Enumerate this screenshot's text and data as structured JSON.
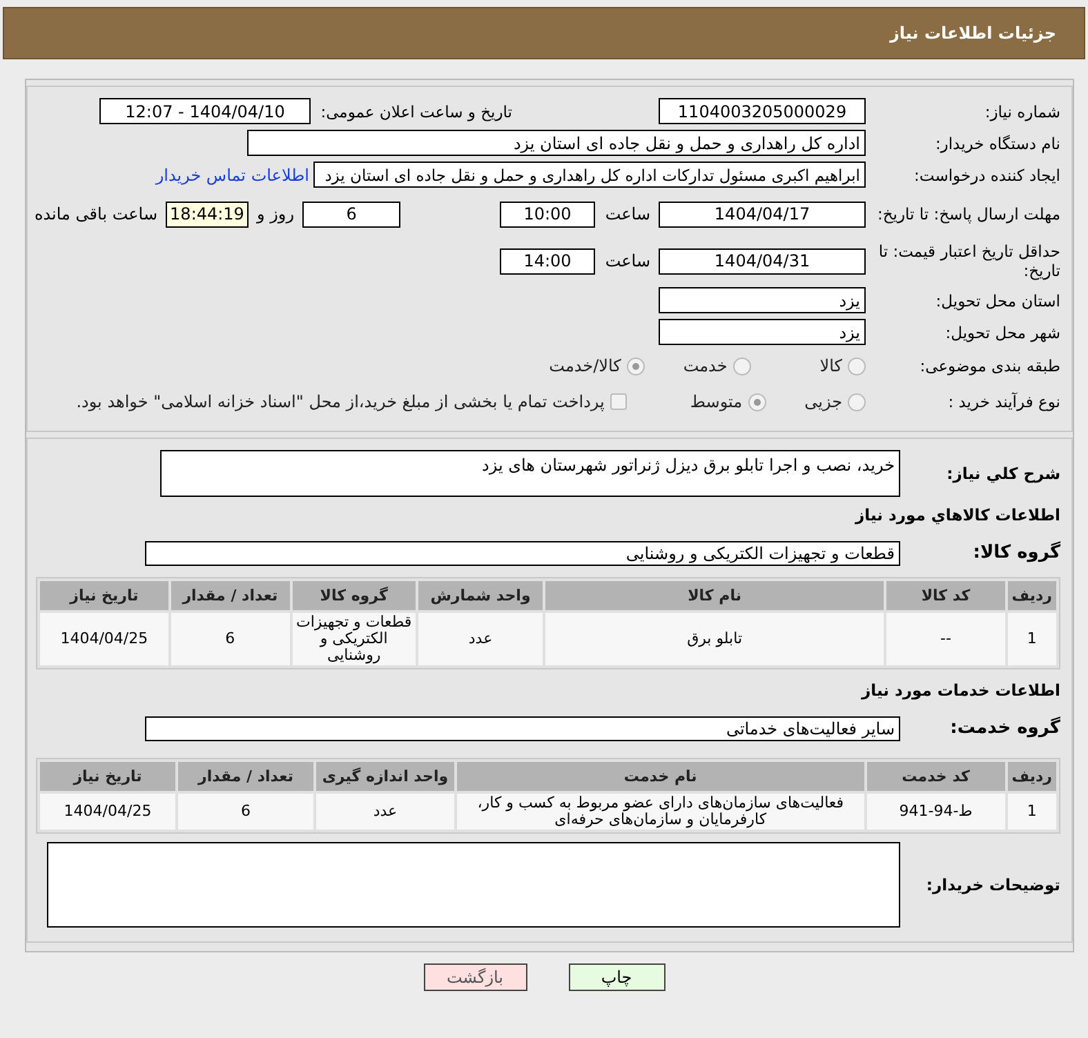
{
  "header": {
    "title": "جزئیات اطلاعات نیاز"
  },
  "need_number": {
    "label": "شماره نیاز:",
    "value": "1104003205000029"
  },
  "announce": {
    "label": "تاریخ و ساعت اعلان عمومی:",
    "value": "1404/04/10 - 12:07"
  },
  "buyer_org": {
    "label": "نام دستگاه خریدار:",
    "value": "اداره کل راهداری و حمل و نقل جاده ای استان یزد"
  },
  "requester": {
    "label": "ایجاد کننده درخواست:",
    "value": "ابراهیم اکبری مسئول تدارکات اداره کل راهداری و حمل و نقل جاده ای استان یزد",
    "link": "اطلاعات تماس خریدار"
  },
  "deadline": {
    "label": "مهلت ارسال پاسخ: تا تاریخ:",
    "date": "1404/04/17",
    "time_label": "ساعت",
    "time": "10:00",
    "days": "6",
    "days_label": "روز و",
    "remaining": "18:44:19",
    "remaining_label": "ساعت باقی مانده"
  },
  "validity": {
    "label": "حداقل تاریخ اعتبار قیمت: تا تاریخ:",
    "date": "1404/04/31",
    "time_label": "ساعت",
    "time": "14:00"
  },
  "province": {
    "label": "استان محل تحویل:",
    "value": "یزد"
  },
  "city": {
    "label": "شهر محل تحویل:",
    "value": "یزد"
  },
  "category": {
    "label": "طبقه بندی موضوعی:",
    "options": [
      {
        "label": "کالا",
        "selected": false
      },
      {
        "label": "خدمت",
        "selected": false
      },
      {
        "label": "کالا/خدمت",
        "selected": true
      }
    ]
  },
  "process": {
    "label": "نوع فرآیند خرید :",
    "options": [
      {
        "label": "جزیی",
        "selected": false
      },
      {
        "label": "متوسط",
        "selected": true
      }
    ],
    "payment": {
      "label": "پرداخت تمام یا بخشی از مبلغ خرید،از محل \"اسناد خزانه اسلامی\" خواهد بود.",
      "checked": false
    }
  },
  "description": {
    "label": "شرح کلي نياز:",
    "value": "خرید، نصب و اجرا تابلو برق دیزل ژنراتور شهرستان های یزد"
  },
  "goods": {
    "title": "اطلاعات کالاهاي مورد نياز",
    "group_label": "گروه کالا:",
    "group_value": "قطعات و تجهیزات الکتریکی و روشنایی",
    "columns": [
      "ردیف",
      "کد کالا",
      "نام کالا",
      "واحد شمارش",
      "گروه کالا",
      "تعداد / مقدار",
      "تاریخ نیاز"
    ],
    "rows": [
      [
        "1",
        "--",
        "تابلو برق",
        "عدد",
        "قطعات و تجهیزات الکتریکی و روشنایی",
        "6",
        "1404/04/25"
      ]
    ]
  },
  "services": {
    "title": "اطلاعات خدمات مورد نیاز",
    "group_label": "گروه خدمت:",
    "group_value": "سایر فعالیت‌های خدماتی",
    "columns": [
      "ردیف",
      "کد خدمت",
      "نام خدمت",
      "واحد اندازه گیری",
      "تعداد / مقدار",
      "تاریخ نیاز"
    ],
    "rows": [
      [
        "1",
        "ط-94-941",
        "فعالیت‌های سازمان‌های دارای عضو مربوط به کسب و کار، کارفرمایان و سازمان‌های حرفه‌ای",
        "عدد",
        "6",
        "1404/04/25"
      ]
    ]
  },
  "buyer_notes": {
    "label": "توضیحات خریدار:"
  },
  "buttons": [
    {
      "label": "چاپ",
      "kind": "print"
    },
    {
      "label": "بازگشت",
      "kind": "back"
    }
  ]
}
